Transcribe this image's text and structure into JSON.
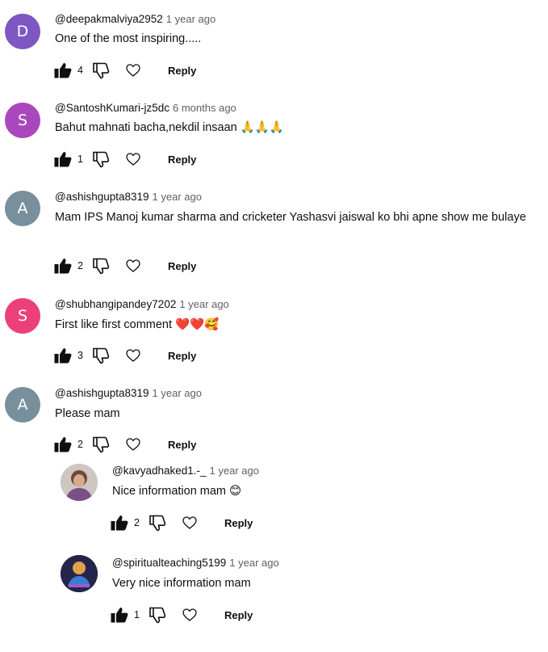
{
  "comments": [
    {
      "author": "@deepakmalviya2952",
      "time": "1 year ago",
      "text": "One of the most inspiring.....",
      "likes": "4",
      "avatar_letter": "D",
      "avatar_color": "#7e57c2",
      "reply_label": "Reply"
    },
    {
      "author": "@SantoshKumari-jz5dc",
      "time": "6 months ago",
      "text": "Bahut mahnati bacha,nekdil insaan 🙏🙏🙏",
      "likes": "1",
      "avatar_letter": "S",
      "avatar_color": "#ab47bc",
      "reply_label": "Reply"
    },
    {
      "author": "@ashishgupta8319",
      "time": "1 year ago",
      "text": "Mam IPS Manoj  kumar  sharma  and cricketer Yashasvi  jaiswal ko bhi apne show me bulaye",
      "likes": "2",
      "avatar_letter": "A",
      "avatar_color": "#78909c",
      "reply_label": "Reply"
    },
    {
      "author": "@shubhangipandey7202",
      "time": "1 year ago",
      "text": "First like first comment ❤️❤️🥰",
      "likes": "3",
      "avatar_letter": "S",
      "avatar_color": "#ec407a",
      "reply_label": "Reply"
    },
    {
      "author": "@ashishgupta8319",
      "time": "1 year ago",
      "text": "Please  mam",
      "likes": "2",
      "avatar_letter": "A",
      "avatar_color": "#78909c",
      "reply_label": "Reply"
    }
  ],
  "replies": [
    {
      "author": "@kavyadhaked1.-_",
      "time": "1 year ago",
      "text": "Nice information mam 😊",
      "likes": "2",
      "reply_label": "Reply"
    },
    {
      "author": "@spiritualteaching5199",
      "time": "1 year ago",
      "text": "Very nice information mam",
      "likes": "1",
      "reply_label": "Reply"
    }
  ]
}
